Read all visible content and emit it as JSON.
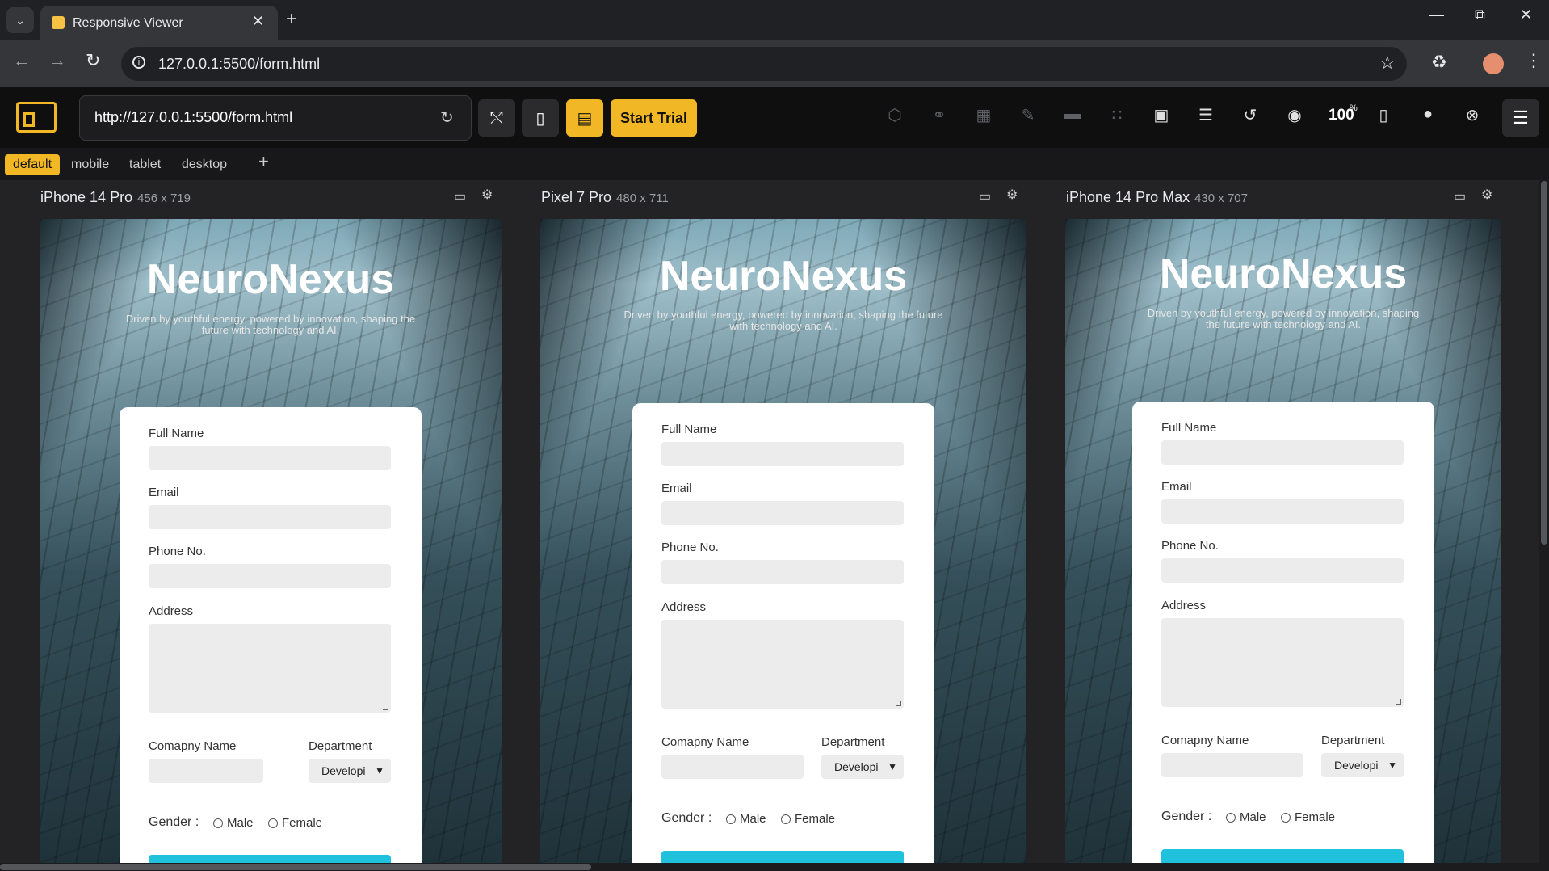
{
  "browser": {
    "tab_title": "Responsive Viewer",
    "address": "127.0.0.1:5500/form.html"
  },
  "extension": {
    "url_value": "http://127.0.0.1:5500/form.html",
    "start_trial_label": "Start Trial",
    "zoom": "100",
    "zoom_unit": "%",
    "presets": [
      "default",
      "mobile",
      "tablet",
      "desktop"
    ],
    "active_preset": "default",
    "accent_color": "#f2b724"
  },
  "devices": [
    {
      "name": "iPhone 14 Pro",
      "size": "456 x 719"
    },
    {
      "name": "Pixel 7 Pro",
      "size": "480 x 711"
    },
    {
      "name": "iPhone 14 Pro Max",
      "size": "430 x 707"
    }
  ],
  "page": {
    "brand": "NeuroNexus",
    "tagline": "Driven by youthful energy, powered by innovation, shaping the future with technology and AI.",
    "labels": {
      "full_name": "Full Name",
      "email": "Email",
      "phone": "Phone No.",
      "address": "Address",
      "company": "Comapny Name",
      "department": "Department",
      "gender": "Gender :",
      "male": "Male",
      "female": "Female"
    },
    "department_value": "Developi",
    "submit_color": "#20c1dc"
  }
}
